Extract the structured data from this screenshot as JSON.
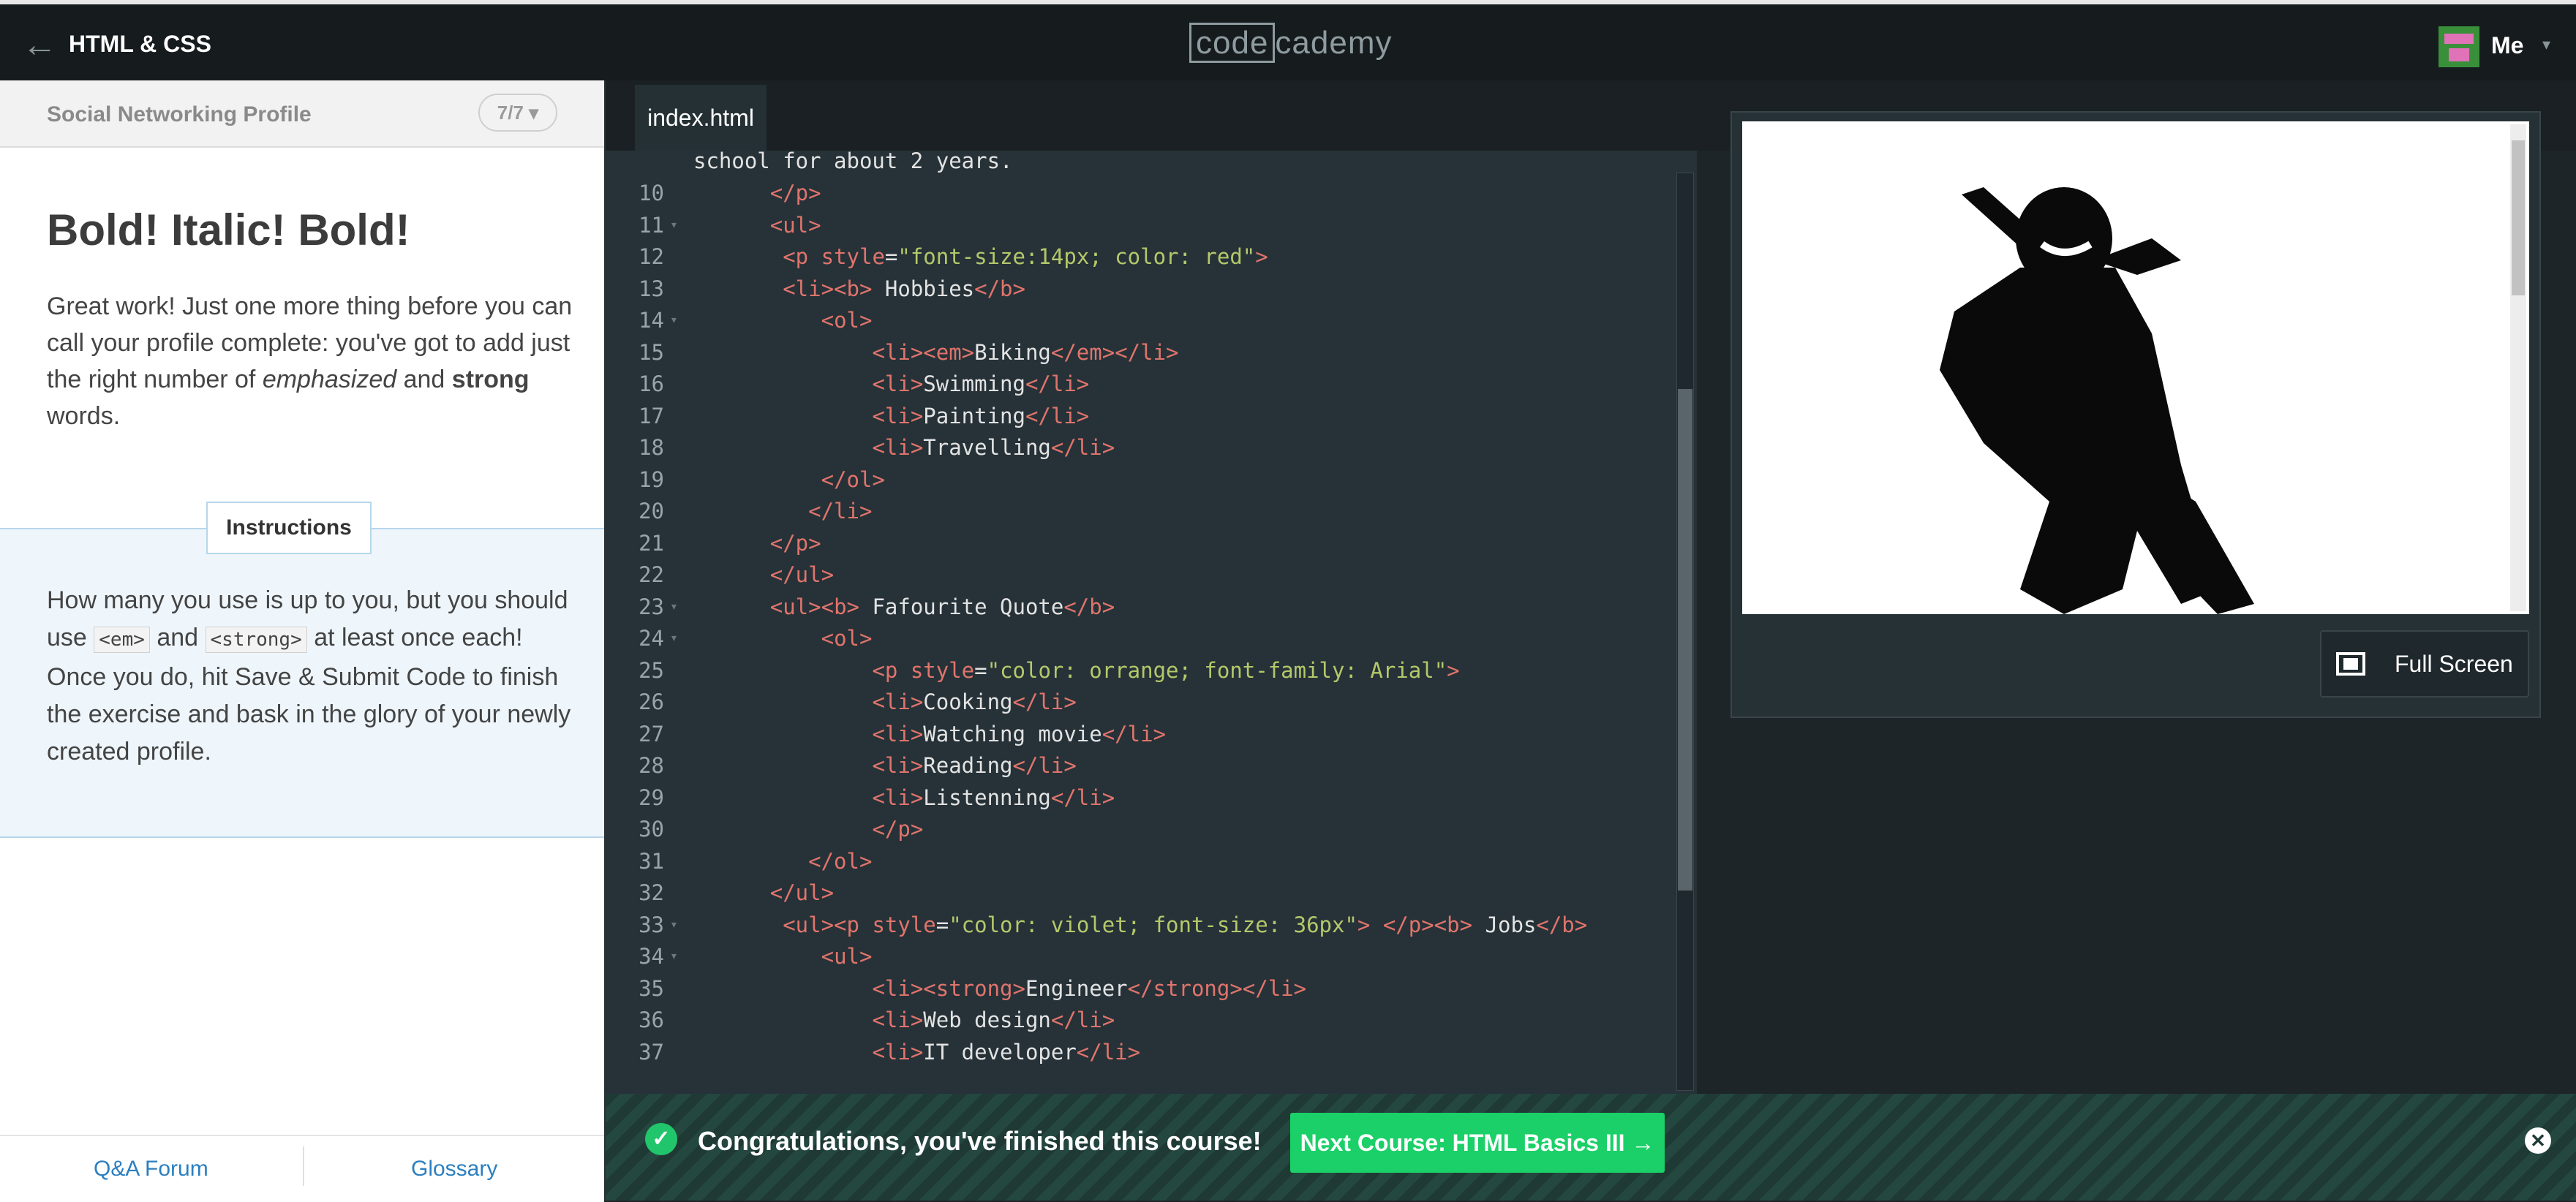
{
  "header": {
    "back_icon": "arrow-left-icon",
    "course_title": "HTML & CSS",
    "logo_part1": "code",
    "logo_part2": "cademy",
    "user_label": "Me"
  },
  "lesson": {
    "project_title": "Social Networking Profile",
    "progress": "7/7",
    "title": "Bold! Italic! Bold!",
    "intro_parts": [
      "Great work! Just one more thing before you can call your profile complete: you've got to add just the right number of ",
      "emphasized",
      " and ",
      "strong",
      " words."
    ],
    "instructions_tab": "Instructions",
    "instructions_parts": [
      "How many you use is up to you, but you should use ",
      "<em>",
      " and ",
      "<strong>",
      " at least once each! Once you do, hit Save & Submit Code to finish the exercise and bask in the glory of your newly created profile."
    ],
    "footer_links": [
      "Q&A Forum",
      "Glossary"
    ]
  },
  "editor": {
    "tab_label": "index.html",
    "top_partial": "school for about 2 years.",
    "lines": [
      {
        "n": "10",
        "fold": false,
        "indent": "      ",
        "parts": [
          [
            "tg",
            "</p>"
          ]
        ]
      },
      {
        "n": "11",
        "fold": true,
        "indent": "      ",
        "parts": [
          [
            "tg",
            "<ul>"
          ]
        ]
      },
      {
        "n": "12",
        "fold": false,
        "indent": "       ",
        "parts": [
          [
            "tg",
            "<p "
          ],
          [
            "at",
            "style"
          ],
          [
            "tx",
            "="
          ],
          [
            "st",
            "\"font-size:14px; color: red\""
          ],
          [
            "tg",
            ">"
          ]
        ]
      },
      {
        "n": "13",
        "fold": false,
        "indent": "       ",
        "parts": [
          [
            "tg",
            "<li><b>"
          ],
          [
            "tx",
            " Hobbies"
          ],
          [
            "tg",
            "</b>"
          ]
        ]
      },
      {
        "n": "14",
        "fold": true,
        "indent": "          ",
        "parts": [
          [
            "tg",
            "<ol>"
          ]
        ]
      },
      {
        "n": "15",
        "fold": false,
        "indent": "              ",
        "parts": [
          [
            "tg",
            "<li><em>"
          ],
          [
            "tx",
            "Biking"
          ],
          [
            "tg",
            "</em></li>"
          ]
        ]
      },
      {
        "n": "16",
        "fold": false,
        "indent": "              ",
        "parts": [
          [
            "tg",
            "<li>"
          ],
          [
            "tx",
            "Swimming"
          ],
          [
            "tg",
            "</li>"
          ]
        ]
      },
      {
        "n": "17",
        "fold": false,
        "indent": "              ",
        "parts": [
          [
            "tg",
            "<li>"
          ],
          [
            "tx",
            "Painting"
          ],
          [
            "tg",
            "</li>"
          ]
        ]
      },
      {
        "n": "18",
        "fold": false,
        "indent": "              ",
        "parts": [
          [
            "tg",
            "<li>"
          ],
          [
            "tx",
            "Travelling"
          ],
          [
            "tg",
            "</li>"
          ]
        ]
      },
      {
        "n": "19",
        "fold": false,
        "indent": "          ",
        "parts": [
          [
            "tg",
            "</ol>"
          ]
        ]
      },
      {
        "n": "20",
        "fold": false,
        "indent": "         ",
        "parts": [
          [
            "tg",
            "</li>"
          ]
        ]
      },
      {
        "n": "21",
        "fold": false,
        "indent": "      ",
        "parts": [
          [
            "tg",
            "</p>"
          ]
        ]
      },
      {
        "n": "22",
        "fold": false,
        "indent": "      ",
        "parts": [
          [
            "tg",
            "</ul>"
          ]
        ]
      },
      {
        "n": "23",
        "fold": true,
        "indent": "      ",
        "parts": [
          [
            "tg",
            "<ul><b>"
          ],
          [
            "tx",
            " Fafourite Quote"
          ],
          [
            "tg",
            "</b>"
          ]
        ]
      },
      {
        "n": "24",
        "fold": true,
        "indent": "          ",
        "parts": [
          [
            "tg",
            "<ol>"
          ]
        ]
      },
      {
        "n": "25",
        "fold": false,
        "indent": "              ",
        "parts": [
          [
            "tg",
            "<p "
          ],
          [
            "at",
            "style"
          ],
          [
            "tx",
            "="
          ],
          [
            "st",
            "\"color: orrange; font-family: Arial\""
          ],
          [
            "tg",
            ">"
          ]
        ]
      },
      {
        "n": "26",
        "fold": false,
        "indent": "              ",
        "parts": [
          [
            "tg",
            "<li>"
          ],
          [
            "tx",
            "Cooking"
          ],
          [
            "tg",
            "</li>"
          ]
        ]
      },
      {
        "n": "27",
        "fold": false,
        "indent": "              ",
        "parts": [
          [
            "tg",
            "<li>"
          ],
          [
            "tx",
            "Watching movie"
          ],
          [
            "tg",
            "</li>"
          ]
        ]
      },
      {
        "n": "28",
        "fold": false,
        "indent": "              ",
        "parts": [
          [
            "tg",
            "<li>"
          ],
          [
            "tx",
            "Reading"
          ],
          [
            "tg",
            "</li>"
          ]
        ]
      },
      {
        "n": "29",
        "fold": false,
        "indent": "              ",
        "parts": [
          [
            "tg",
            "<li>"
          ],
          [
            "tx",
            "Listenning"
          ],
          [
            "tg",
            "</li>"
          ]
        ]
      },
      {
        "n": "30",
        "fold": false,
        "indent": "              ",
        "parts": [
          [
            "tg",
            "</p>"
          ]
        ]
      },
      {
        "n": "31",
        "fold": false,
        "indent": "         ",
        "parts": [
          [
            "tg",
            "</ol>"
          ]
        ]
      },
      {
        "n": "32",
        "fold": false,
        "indent": "      ",
        "parts": [
          [
            "tg",
            "</ul>"
          ]
        ]
      },
      {
        "n": "33",
        "fold": true,
        "indent": "       ",
        "parts": [
          [
            "tg",
            "<ul><p "
          ],
          [
            "at",
            "style"
          ],
          [
            "tx",
            "="
          ],
          [
            "st",
            "\"color: violet; font-size: 36px\""
          ],
          [
            "tg",
            "> </p><b>"
          ],
          [
            "tx",
            " Jobs"
          ],
          [
            "tg",
            "</b>"
          ]
        ]
      },
      {
        "n": "34",
        "fold": true,
        "indent": "          ",
        "parts": [
          [
            "tg",
            "<ul>"
          ]
        ]
      },
      {
        "n": "35",
        "fold": false,
        "indent": "              ",
        "parts": [
          [
            "tg",
            "<li><strong>"
          ],
          [
            "tx",
            "Engineer"
          ],
          [
            "tg",
            "</strong></li>"
          ]
        ]
      },
      {
        "n": "36",
        "fold": false,
        "indent": "              ",
        "parts": [
          [
            "tg",
            "<li>"
          ],
          [
            "tx",
            "Web design"
          ],
          [
            "tg",
            "</li>"
          ]
        ]
      },
      {
        "n": "37",
        "fold": false,
        "indent": "              ",
        "parts": [
          [
            "tg",
            "<li>"
          ],
          [
            "tx",
            "IT developer"
          ],
          [
            "tg",
            "</li>"
          ]
        ]
      }
    ]
  },
  "preview": {
    "image_icon": "ninja-silhouette-icon",
    "fullscreen_label": "Full Screen"
  },
  "completion": {
    "message": "Congratulations, you've finished this course!",
    "next_button": "Next Course: HTML Basics III →",
    "close_icon": "close-icon"
  },
  "colors": {
    "accent_green": "#1bd068",
    "tag": "#e0746c",
    "string": "#b5c86a"
  }
}
